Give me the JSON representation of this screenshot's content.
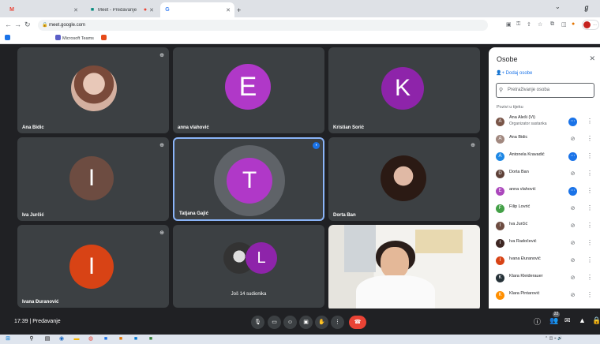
{
  "browser": {
    "tabs": [
      {
        "label": "",
        "icon": "gmail-icon",
        "color": "#ea4335"
      },
      {
        "label": "Meet - Predavanje",
        "icon": "meet-icon",
        "color": "#00897b"
      },
      {
        "label": "",
        "icon": "google-icon",
        "color": "#4285f4"
      }
    ],
    "address": "meet.google.com",
    "bookmarks": [
      {
        "label": "",
        "color": "#1a73e8"
      },
      {
        "label": "Microsoft Teams",
        "color": "#5b5fc7"
      },
      {
        "label": "",
        "color": "#e64a19"
      }
    ]
  },
  "tiles": [
    {
      "name": "Ana Bidic",
      "type": "photo",
      "photo_color": "#c49a89"
    },
    {
      "name": "anna vlahović",
      "type": "letter",
      "letter": "E",
      "color": "#b038c8"
    },
    {
      "name": "Kristian Sorić",
      "type": "letter",
      "letter": "K",
      "color": "#8e24aa"
    },
    {
      "name": "Iva Jurčić",
      "type": "letter",
      "letter": "I",
      "color": "#6d4c41"
    },
    {
      "name": "Tatjana Gajić",
      "type": "letter",
      "letter": "T",
      "color": "#b038c8",
      "active": true
    },
    {
      "name": "Dorta Ban",
      "type": "photo",
      "photo_color": "#6d4c41"
    },
    {
      "name": "Ivana Đuranović",
      "type": "letter",
      "letter": "I",
      "color": "#d84315"
    },
    {
      "name": "Još 14 sudionika",
      "type": "others",
      "letter": "L",
      "color": "#8e24aa"
    },
    {
      "name": "",
      "type": "video"
    }
  ],
  "panel": {
    "title": "Osobe",
    "add_label": "Dodaj osobe",
    "search_placeholder": "Pretraživanje osoba",
    "section": "Pozivi u tijeku",
    "people": [
      {
        "name": "Ana Aleši (Vi)",
        "sub": "Organizator sastanka",
        "initial": "A",
        "color": "#795548",
        "mic": "on"
      },
      {
        "name": "Ana Bidic",
        "sub": "",
        "initial": "A",
        "color": "#a1887f",
        "mic": "off"
      },
      {
        "name": "Antonela Kravadić",
        "sub": "",
        "initial": "A",
        "color": "#1e88e5",
        "mic": "on"
      },
      {
        "name": "Dorta Ban",
        "sub": "",
        "initial": "D",
        "color": "#5d4037",
        "mic": "off"
      },
      {
        "name": "anna vlahović",
        "sub": "",
        "initial": "E",
        "color": "#ab47bc",
        "mic": "on"
      },
      {
        "name": "Filip Lovrić",
        "sub": "",
        "initial": "F",
        "color": "#43a047",
        "mic": "off"
      },
      {
        "name": "Iva Jurčić",
        "sub": "",
        "initial": "I",
        "color": "#6d4c41",
        "mic": "off"
      },
      {
        "name": "Iva Radočević",
        "sub": "",
        "initial": "I",
        "color": "#3e2723",
        "mic": "off"
      },
      {
        "name": "Ivana Đuranović",
        "sub": "",
        "initial": "I",
        "color": "#d84315",
        "mic": "off"
      },
      {
        "name": "Klara Kleiderauer",
        "sub": "",
        "initial": "K",
        "color": "#263238",
        "mic": "off"
      },
      {
        "name": "Klara Pintarović",
        "sub": "",
        "initial": "K",
        "color": "#ff8f00",
        "mic": "off"
      }
    ]
  },
  "bottom": {
    "time": "17:39",
    "meeting": "Predavanje",
    "people_count": "22"
  },
  "colors": {
    "meet_bg": "#202124",
    "tile_bg": "#3c4043",
    "accent": "#1a73e8",
    "hangup": "#ea4335"
  }
}
